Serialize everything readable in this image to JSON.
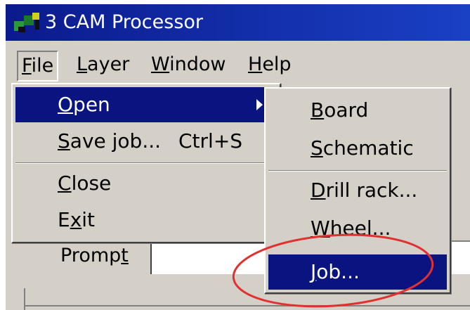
{
  "window": {
    "title": "3 CAM Processor"
  },
  "menubar": {
    "items": [
      "File",
      "Layer",
      "Window",
      "Help"
    ]
  },
  "file_menu": {
    "open": "Open",
    "save_job": "Save job...",
    "save_job_shortcut": "Ctrl+S",
    "close": "Close",
    "exit": "Exit"
  },
  "open_submenu": {
    "board": "Board",
    "schematic": "Schematic",
    "drill_rack": "Drill rack...",
    "wheel": "Wheel...",
    "job": "Job..."
  },
  "prompt": {
    "label": "Prompt",
    "value": ""
  },
  "colors": {
    "title_bar": "#0b1a8c",
    "highlight": "#0a1480",
    "window_face": "#d4d0c8",
    "annotation_ellipse": "#e03030"
  }
}
